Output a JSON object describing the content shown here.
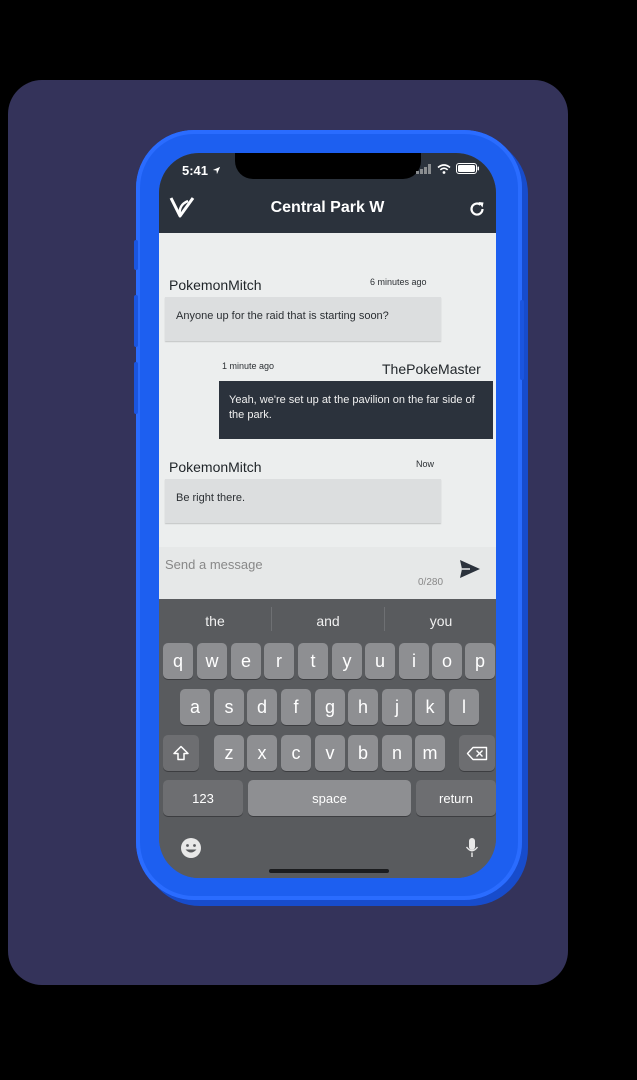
{
  "status": {
    "time": "5:41"
  },
  "header": {
    "title": "Central Park W"
  },
  "messages": [
    {
      "user": "PokemonMitch",
      "time": "6 minutes ago",
      "text": "Anyone up for the raid that is starting soon?"
    },
    {
      "user": "ThePokeMaster",
      "time": "1 minute ago",
      "text": "Yeah, we're set up at the pavilion on the far side of the park."
    },
    {
      "user": "PokemonMitch",
      "time": "Now",
      "text": "Be right there."
    }
  ],
  "composer": {
    "placeholder": "Send a message",
    "counter": "0/280"
  },
  "keyboard": {
    "suggestions": [
      "the",
      "and",
      "you"
    ],
    "row1": [
      "q",
      "w",
      "e",
      "r",
      "t",
      "y",
      "u",
      "i",
      "o",
      "p"
    ],
    "row2": [
      "a",
      "s",
      "d",
      "f",
      "g",
      "h",
      "j",
      "k",
      "l"
    ],
    "row3": [
      "z",
      "x",
      "c",
      "v",
      "b",
      "n",
      "m"
    ],
    "numbers": "123",
    "space": "space",
    "return": "return"
  },
  "colors": {
    "phone": "#1d5ff0",
    "header": "#2b323c",
    "backdrop": "#34335a"
  }
}
